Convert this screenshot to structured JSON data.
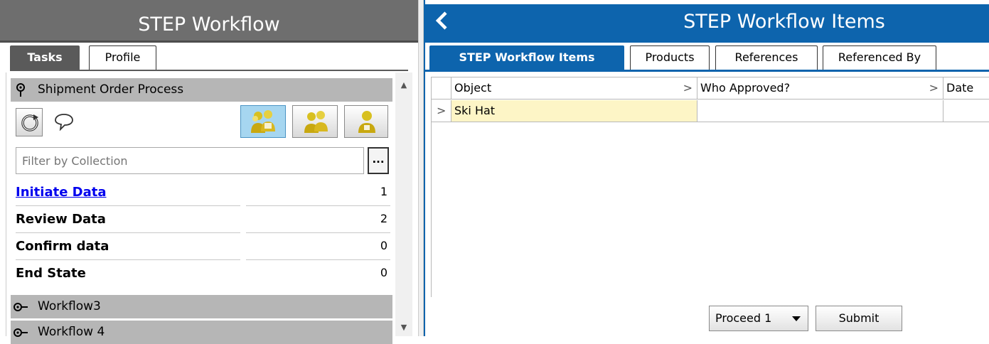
{
  "left": {
    "title": "STEP Workflow",
    "tabs": [
      {
        "label": "Tasks",
        "active": true
      },
      {
        "label": "Profile",
        "active": false
      }
    ],
    "shipment_group": {
      "label": "Shipment Order Process"
    },
    "filter": {
      "placeholder": "Filter by Collection",
      "button_label": "..."
    },
    "states": [
      {
        "label": "Initiate Data",
        "count": "1"
      },
      {
        "label": "Review Data",
        "count": "2"
      },
      {
        "label": "Confirm data",
        "count": "0"
      },
      {
        "label": "End State",
        "count": "0"
      }
    ],
    "other_groups": [
      {
        "label": "Workflow3"
      },
      {
        "label": "Workflow 4"
      }
    ],
    "toolbar_icons": [
      "refresh-icon",
      "comment-icon",
      "group-users-icon",
      "multiple-users-icon",
      "single-user-icon"
    ]
  },
  "right": {
    "title": "STEP Workflow Items",
    "tabs": [
      {
        "label": "STEP Workflow Items",
        "active": true
      },
      {
        "label": "Products",
        "active": false
      },
      {
        "label": "References",
        "active": false
      },
      {
        "label": "Referenced By",
        "active": false
      }
    ],
    "grid": {
      "columns": [
        "Object",
        "Who Approved?",
        "Date"
      ],
      "rows": [
        {
          "object": "Ski Hat",
          "who_approved": "",
          "date": ""
        }
      ]
    },
    "actions": {
      "proceed_label": "Proceed 1",
      "submit_label": "Submit"
    }
  },
  "colors": {
    "left_header": "#6e6e6e",
    "right_header": "#0d64ad",
    "group_bar": "#b6b6b6",
    "selected_cell": "#fdf5c6",
    "link": "#0000ee"
  }
}
